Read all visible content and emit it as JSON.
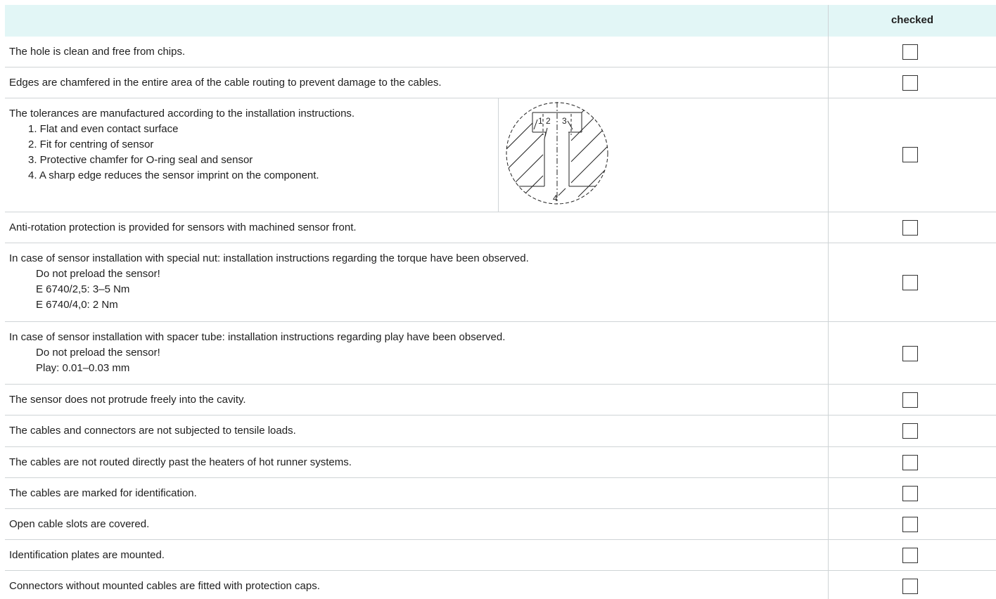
{
  "header": {
    "checked_label": "checked"
  },
  "rows": [
    {
      "text": "The hole is clean and free from chips."
    },
    {
      "text": "Edges are chamfered in the entire area of the cable routing to prevent damage to the cables."
    },
    {
      "text": "The tolerances are manufactured according to the installation instructions.",
      "items": [
        "1. Flat and even contact surface",
        "2. Fit for centring of sensor",
        "3. Protective chamfer for O-ring seal and sensor",
        "4. A sharp edge reduces the sensor imprint on the component."
      ],
      "figure_labels": [
        "1",
        "2",
        "3",
        "4"
      ]
    },
    {
      "text": "Anti-rotation protection is provided for sensors with machined sensor front."
    },
    {
      "text": "In case of sensor installation with special nut: installation instructions regarding the torque have been observed.",
      "items": [
        "Do not preload the sensor!",
        "E 6740/2,5: 3–5 Nm",
        "E 6740/4,0: 2 Nm"
      ]
    },
    {
      "text": "In case of sensor installation with spacer tube: installation instructions regarding play have been observed.",
      "items": [
        "Do not preload the sensor!",
        "Play: 0.01–0.03 mm"
      ]
    },
    {
      "text": "The sensor does not protrude freely into the cavity."
    },
    {
      "text": "The cables and connectors are not subjected to tensile loads."
    },
    {
      "text": "The cables are not routed directly past the heaters of hot runner systems."
    },
    {
      "text": "The cables are marked for identification."
    },
    {
      "text": "Open cable slots are covered."
    },
    {
      "text": "Identification plates are mounted."
    },
    {
      "text": "Connectors without mounted cables are fitted with protection caps."
    }
  ]
}
